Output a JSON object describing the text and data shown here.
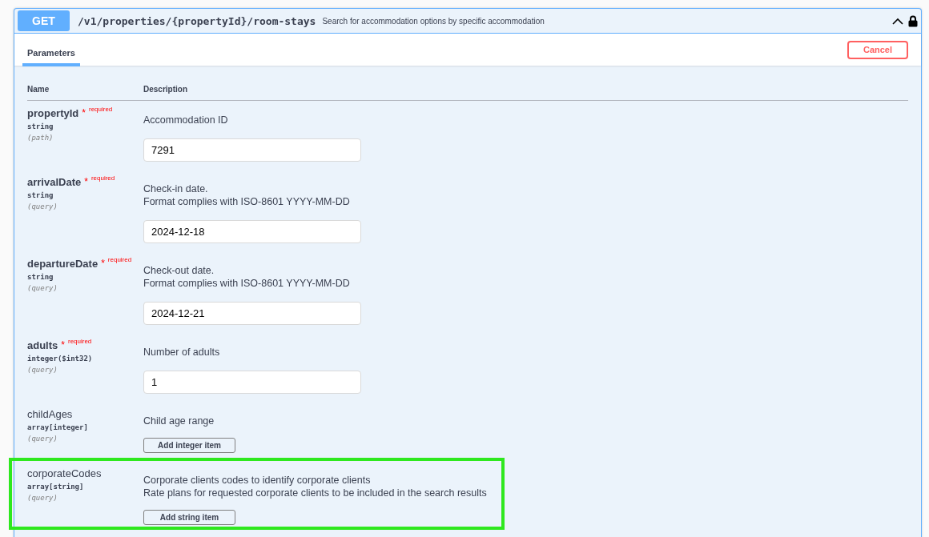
{
  "operation": {
    "method": "GET",
    "path": "/v1/properties/{propertyId}/room-stays",
    "summary": "Search for accommodation options by specific accommodation",
    "expanded": true
  },
  "tabs": [
    {
      "label": "Parameters",
      "selected": true
    }
  ],
  "cancel_button": "Cancel",
  "table": {
    "columns": [
      "Name",
      "Description"
    ]
  },
  "parameters": [
    {
      "name": "propertyId",
      "required": true,
      "required_label": "required",
      "star": "*",
      "type": "string",
      "location": "(path)",
      "description": [
        "Accommodation ID"
      ],
      "control": {
        "kind": "input",
        "value": "7291"
      },
      "highlighted": false
    },
    {
      "name": "arrivalDate",
      "required": true,
      "required_label": "required",
      "star": "*",
      "type": "string",
      "location": "(query)",
      "description": [
        "Check-in date.",
        "Format complies with ISO-8601 YYYY-MM-DD"
      ],
      "control": {
        "kind": "input",
        "value": "2024-12-18"
      },
      "highlighted": false
    },
    {
      "name": "departureDate",
      "required": true,
      "required_label": "required",
      "star": "*",
      "type": "string",
      "location": "(query)",
      "description": [
        "Check-out date.",
        "Format complies with ISO-8601 YYYY-MM-DD"
      ],
      "control": {
        "kind": "input",
        "value": "2024-12-21"
      },
      "highlighted": false
    },
    {
      "name": "adults",
      "required": true,
      "required_label": "required",
      "star": "*",
      "type": "integer($int32)",
      "location": "(query)",
      "description": [
        "Number of adults"
      ],
      "control": {
        "kind": "input",
        "value": "1"
      },
      "highlighted": false
    },
    {
      "name": "childAges",
      "required": false,
      "type": "array[integer]",
      "location": "(query)",
      "description": [
        "Child age range"
      ],
      "control": {
        "kind": "button",
        "label": "Add integer item"
      },
      "highlighted": false
    },
    {
      "name": "corporateCodes",
      "required": false,
      "type": "array[string]",
      "location": "(query)",
      "description": [
        "Corporate clients codes to identify corporate clients",
        "Rate plans for requested corporate clients to be included in the search results"
      ],
      "control": {
        "kind": "button",
        "label": "Add string item"
      },
      "highlighted": true
    }
  ]
}
